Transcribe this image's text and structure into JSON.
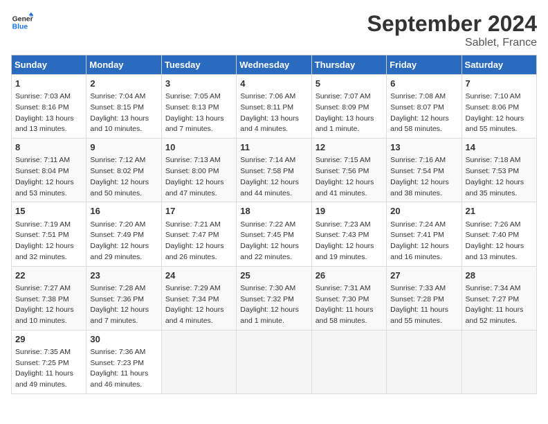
{
  "header": {
    "logo_line1": "General",
    "logo_line2": "Blue",
    "title": "September 2024",
    "subtitle": "Sablet, France"
  },
  "weekdays": [
    "Sunday",
    "Monday",
    "Tuesday",
    "Wednesday",
    "Thursday",
    "Friday",
    "Saturday"
  ],
  "weeks": [
    [
      {
        "day": "1",
        "lines": [
          "Sunrise: 7:03 AM",
          "Sunset: 8:16 PM",
          "Daylight: 13 hours",
          "and 13 minutes."
        ]
      },
      {
        "day": "2",
        "lines": [
          "Sunrise: 7:04 AM",
          "Sunset: 8:15 PM",
          "Daylight: 13 hours",
          "and 10 minutes."
        ]
      },
      {
        "day": "3",
        "lines": [
          "Sunrise: 7:05 AM",
          "Sunset: 8:13 PM",
          "Daylight: 13 hours",
          "and 7 minutes."
        ]
      },
      {
        "day": "4",
        "lines": [
          "Sunrise: 7:06 AM",
          "Sunset: 8:11 PM",
          "Daylight: 13 hours",
          "and 4 minutes."
        ]
      },
      {
        "day": "5",
        "lines": [
          "Sunrise: 7:07 AM",
          "Sunset: 8:09 PM",
          "Daylight: 13 hours",
          "and 1 minute."
        ]
      },
      {
        "day": "6",
        "lines": [
          "Sunrise: 7:08 AM",
          "Sunset: 8:07 PM",
          "Daylight: 12 hours",
          "and 58 minutes."
        ]
      },
      {
        "day": "7",
        "lines": [
          "Sunrise: 7:10 AM",
          "Sunset: 8:06 PM",
          "Daylight: 12 hours",
          "and 55 minutes."
        ]
      }
    ],
    [
      {
        "day": "8",
        "lines": [
          "Sunrise: 7:11 AM",
          "Sunset: 8:04 PM",
          "Daylight: 12 hours",
          "and 53 minutes."
        ]
      },
      {
        "day": "9",
        "lines": [
          "Sunrise: 7:12 AM",
          "Sunset: 8:02 PM",
          "Daylight: 12 hours",
          "and 50 minutes."
        ]
      },
      {
        "day": "10",
        "lines": [
          "Sunrise: 7:13 AM",
          "Sunset: 8:00 PM",
          "Daylight: 12 hours",
          "and 47 minutes."
        ]
      },
      {
        "day": "11",
        "lines": [
          "Sunrise: 7:14 AM",
          "Sunset: 7:58 PM",
          "Daylight: 12 hours",
          "and 44 minutes."
        ]
      },
      {
        "day": "12",
        "lines": [
          "Sunrise: 7:15 AM",
          "Sunset: 7:56 PM",
          "Daylight: 12 hours",
          "and 41 minutes."
        ]
      },
      {
        "day": "13",
        "lines": [
          "Sunrise: 7:16 AM",
          "Sunset: 7:54 PM",
          "Daylight: 12 hours",
          "and 38 minutes."
        ]
      },
      {
        "day": "14",
        "lines": [
          "Sunrise: 7:18 AM",
          "Sunset: 7:53 PM",
          "Daylight: 12 hours",
          "and 35 minutes."
        ]
      }
    ],
    [
      {
        "day": "15",
        "lines": [
          "Sunrise: 7:19 AM",
          "Sunset: 7:51 PM",
          "Daylight: 12 hours",
          "and 32 minutes."
        ]
      },
      {
        "day": "16",
        "lines": [
          "Sunrise: 7:20 AM",
          "Sunset: 7:49 PM",
          "Daylight: 12 hours",
          "and 29 minutes."
        ]
      },
      {
        "day": "17",
        "lines": [
          "Sunrise: 7:21 AM",
          "Sunset: 7:47 PM",
          "Daylight: 12 hours",
          "and 26 minutes."
        ]
      },
      {
        "day": "18",
        "lines": [
          "Sunrise: 7:22 AM",
          "Sunset: 7:45 PM",
          "Daylight: 12 hours",
          "and 22 minutes."
        ]
      },
      {
        "day": "19",
        "lines": [
          "Sunrise: 7:23 AM",
          "Sunset: 7:43 PM",
          "Daylight: 12 hours",
          "and 19 minutes."
        ]
      },
      {
        "day": "20",
        "lines": [
          "Sunrise: 7:24 AM",
          "Sunset: 7:41 PM",
          "Daylight: 12 hours",
          "and 16 minutes."
        ]
      },
      {
        "day": "21",
        "lines": [
          "Sunrise: 7:26 AM",
          "Sunset: 7:40 PM",
          "Daylight: 12 hours",
          "and 13 minutes."
        ]
      }
    ],
    [
      {
        "day": "22",
        "lines": [
          "Sunrise: 7:27 AM",
          "Sunset: 7:38 PM",
          "Daylight: 12 hours",
          "and 10 minutes."
        ]
      },
      {
        "day": "23",
        "lines": [
          "Sunrise: 7:28 AM",
          "Sunset: 7:36 PM",
          "Daylight: 12 hours",
          "and 7 minutes."
        ]
      },
      {
        "day": "24",
        "lines": [
          "Sunrise: 7:29 AM",
          "Sunset: 7:34 PM",
          "Daylight: 12 hours",
          "and 4 minutes."
        ]
      },
      {
        "day": "25",
        "lines": [
          "Sunrise: 7:30 AM",
          "Sunset: 7:32 PM",
          "Daylight: 12 hours",
          "and 1 minute."
        ]
      },
      {
        "day": "26",
        "lines": [
          "Sunrise: 7:31 AM",
          "Sunset: 7:30 PM",
          "Daylight: 11 hours",
          "and 58 minutes."
        ]
      },
      {
        "day": "27",
        "lines": [
          "Sunrise: 7:33 AM",
          "Sunset: 7:28 PM",
          "Daylight: 11 hours",
          "and 55 minutes."
        ]
      },
      {
        "day": "28",
        "lines": [
          "Sunrise: 7:34 AM",
          "Sunset: 7:27 PM",
          "Daylight: 11 hours",
          "and 52 minutes."
        ]
      }
    ],
    [
      {
        "day": "29",
        "lines": [
          "Sunrise: 7:35 AM",
          "Sunset: 7:25 PM",
          "Daylight: 11 hours",
          "and 49 minutes."
        ]
      },
      {
        "day": "30",
        "lines": [
          "Sunrise: 7:36 AM",
          "Sunset: 7:23 PM",
          "Daylight: 11 hours",
          "and 46 minutes."
        ]
      },
      null,
      null,
      null,
      null,
      null
    ]
  ]
}
